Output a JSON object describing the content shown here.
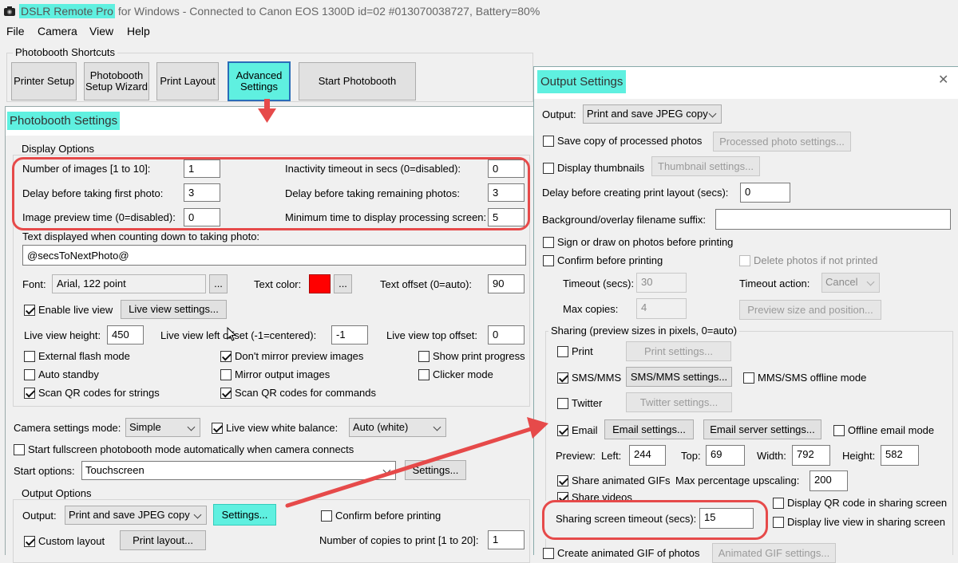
{
  "app": {
    "name": "DSLR Remote Pro",
    "title_rest": "for Windows - Connected to Canon EOS 1300D id=02 #013070038727, Battery=80%"
  },
  "menu": [
    "File",
    "Camera",
    "View",
    "Help"
  ],
  "shortcuts": {
    "title": "Photobooth Shortcuts",
    "printer_setup": "Printer Setup",
    "wizard_1": "Photobooth",
    "wizard_2": "Setup Wizard",
    "print_layout": "Print Layout",
    "advanced_1": "Advanced",
    "advanced_2": "Settings",
    "start": "Start Photobooth"
  },
  "photobooth": {
    "title": "Photobooth Settings",
    "display_options": "Display Options",
    "num_images_label": "Number of images [1 to 10]:",
    "num_images": "1",
    "delay_first_label": "Delay before taking first photo:",
    "delay_first": "3",
    "preview_time_label": "Image preview time (0=disabled):",
    "preview_time": "0",
    "inactivity_label": "Inactivity timeout in secs (0=disabled):",
    "inactivity": "0",
    "delay_remaining_label": "Delay before taking remaining photos:",
    "delay_remaining": "3",
    "min_processing_label": "Minimum time to display processing screen:",
    "min_processing": "5",
    "countdown_label": "Text displayed when counting down to taking photo:",
    "countdown_text": "@secsToNextPhoto@",
    "font_label": "Font:",
    "font_value": "Arial, 122 point",
    "ellipsis": "...",
    "text_color_label": "Text color:",
    "text_color": "#ff0000",
    "text_offset_label": "Text offset (0=auto):",
    "text_offset": "90",
    "enable_live_view": "Enable live view",
    "live_view_settings": "Live view settings...",
    "lv_height_label": "Live view height:",
    "lv_height": "450",
    "lv_left_label": "Live view left offset (-1=centered):",
    "lv_left": "-1",
    "lv_top_label": "Live view top offset:",
    "lv_top": "0",
    "external_flash": "External flash mode",
    "dont_mirror": "Don't mirror preview images",
    "show_progress": "Show print progress",
    "auto_standby": "Auto standby",
    "mirror_output": "Mirror output images",
    "clicker_mode": "Clicker mode",
    "scan_qr_strings": "Scan QR codes for strings",
    "scan_qr_commands": "Scan QR codes for commands",
    "camera_mode_label": "Camera settings mode:",
    "camera_mode": "Simple",
    "lv_white_balance": "Live view white balance:",
    "white_balance": "Auto (white)",
    "start_fullscreen": "Start fullscreen photobooth mode automatically when camera connects",
    "start_options_label": "Start options:",
    "start_options": "Touchscreen",
    "settings_btn": "Settings...",
    "output_options": "Output Options",
    "output_label": "Output:",
    "output_value": "Print and save JPEG copy",
    "confirm_printing": "Confirm before printing",
    "custom_layout": "Custom layout",
    "print_layout_btn": "Print layout...",
    "copies_label": "Number of copies to print [1 to 20]:",
    "copies": "1"
  },
  "output": {
    "title": "Output Settings",
    "close": "✕",
    "output_label": "Output:",
    "output_value": "Print and save JPEG copy",
    "save_copy": "Save copy of processed photos",
    "processed_settings": "Processed photo settings...",
    "display_thumbnails": "Display thumbnails",
    "thumbnail_settings": "Thumbnail settings...",
    "delay_layout_label": "Delay before creating print layout (secs):",
    "delay_layout": "0",
    "bg_suffix_label": "Background/overlay filename suffix:",
    "bg_suffix": "",
    "sign_draw": "Sign or draw on photos before printing",
    "confirm_printing": "Confirm before printing",
    "delete_not_printed": "Delete photos if not printed",
    "timeout_label": "Timeout (secs):",
    "timeout": "30",
    "timeout_action_label": "Timeout action:",
    "timeout_action": "Cancel",
    "max_copies_label": "Max copies:",
    "max_copies": "4",
    "preview_size_btn": "Preview size and position...",
    "sharing_title": "Sharing (preview sizes in pixels, 0=auto)",
    "print": "Print",
    "print_settings": "Print settings...",
    "sms": "SMS/MMS",
    "sms_settings": "SMS/MMS settings...",
    "sms_offline": "MMS/SMS offline mode",
    "twitter": "Twitter",
    "twitter_settings": "Twitter settings...",
    "email": "Email",
    "email_settings": "Email settings...",
    "email_server": "Email server settings...",
    "offline_email": "Offline email mode",
    "preview_label": "Preview:",
    "left_label": "Left:",
    "left": "244",
    "top_label": "Top:",
    "top": "69",
    "width_label": "Width:",
    "width": "792",
    "height_label": "Height:",
    "height": "582",
    "share_gifs": "Share animated GIFs",
    "max_upscale_label": "Max percentage upscaling:",
    "max_upscale": "200",
    "share_videos": "Share videos",
    "display_qr": "Display QR code in sharing screen",
    "sharing_timeout_label": "Sharing screen timeout (secs):",
    "sharing_timeout": "15",
    "display_live_view": "Display live view in sharing screen",
    "create_gif": "Create animated GIF of photos",
    "gif_settings": "Animated GIF settings..."
  },
  "colors": {
    "highlight": "#5ff0e0",
    "annotation": "#e64a4a"
  }
}
